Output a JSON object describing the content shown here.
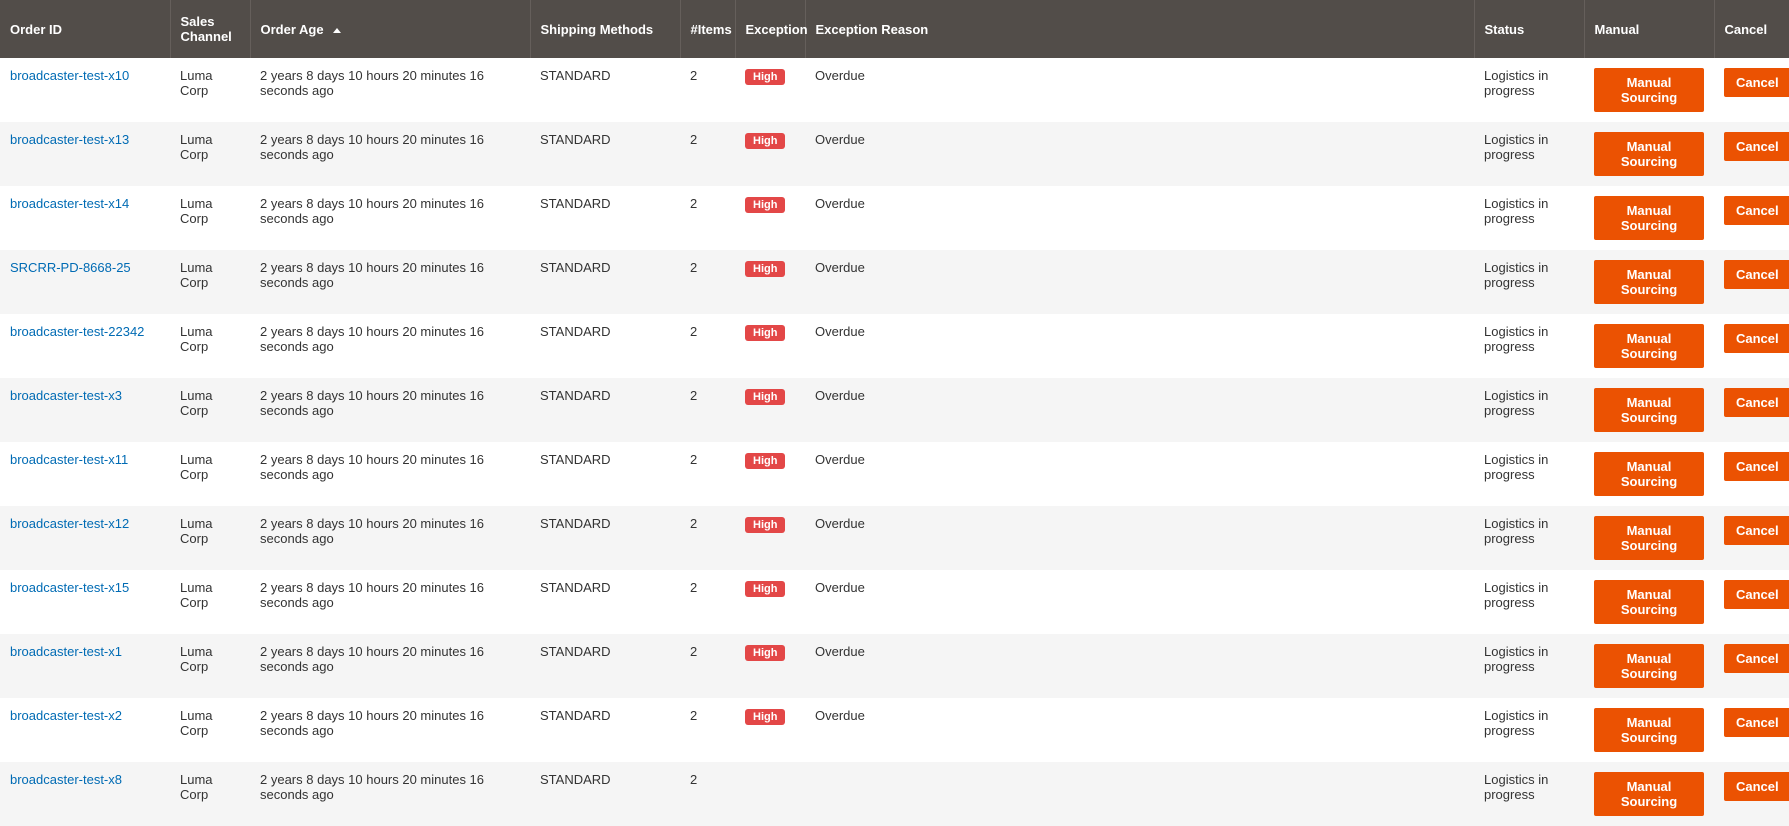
{
  "table": {
    "headers": {
      "order_id": "Order ID",
      "sales_channel": "Sales Channel",
      "order_age": "Order Age",
      "shipping_methods": "Shipping Methods",
      "items": "#Items",
      "exception": "Exception",
      "exception_reason": "Exception Reason",
      "status": "Status",
      "manual": "Manual",
      "cancel": "Cancel"
    },
    "sort_column": "order_age",
    "sort_direction": "asc",
    "buttons": {
      "manual_sourcing": "Manual Sourcing",
      "cancel": "Cancel"
    },
    "exception_labels": {
      "high": "High"
    },
    "rows": [
      {
        "order_id": "broadcaster-test-x10",
        "sales_channel": "Luma Corp",
        "order_age": "2 years 8 days 10 hours 20 minutes 16 seconds ago",
        "shipping_methods": "STANDARD",
        "items": "2",
        "exception": "High",
        "exception_reason": "Overdue",
        "status": "Logistics in progress"
      },
      {
        "order_id": "broadcaster-test-x13",
        "sales_channel": "Luma Corp",
        "order_age": "2 years 8 days 10 hours 20 minutes 16 seconds ago",
        "shipping_methods": "STANDARD",
        "items": "2",
        "exception": "High",
        "exception_reason": "Overdue",
        "status": "Logistics in progress"
      },
      {
        "order_id": "broadcaster-test-x14",
        "sales_channel": "Luma Corp",
        "order_age": "2 years 8 days 10 hours 20 minutes 16 seconds ago",
        "shipping_methods": "STANDARD",
        "items": "2",
        "exception": "High",
        "exception_reason": "Overdue",
        "status": "Logistics in progress"
      },
      {
        "order_id": "SRCRR-PD-8668-25",
        "sales_channel": "Luma Corp",
        "order_age": "2 years 8 days 10 hours 20 minutes 16 seconds ago",
        "shipping_methods": "STANDARD",
        "items": "2",
        "exception": "High",
        "exception_reason": "Overdue",
        "status": "Logistics in progress"
      },
      {
        "order_id": "broadcaster-test-22342",
        "sales_channel": "Luma Corp",
        "order_age": "2 years 8 days 10 hours 20 minutes 16 seconds ago",
        "shipping_methods": "STANDARD",
        "items": "2",
        "exception": "High",
        "exception_reason": "Overdue",
        "status": "Logistics in progress"
      },
      {
        "order_id": "broadcaster-test-x3",
        "sales_channel": "Luma Corp",
        "order_age": "2 years 8 days 10 hours 20 minutes 16 seconds ago",
        "shipping_methods": "STANDARD",
        "items": "2",
        "exception": "High",
        "exception_reason": "Overdue",
        "status": "Logistics in progress"
      },
      {
        "order_id": "broadcaster-test-x11",
        "sales_channel": "Luma Corp",
        "order_age": "2 years 8 days 10 hours 20 minutes 16 seconds ago",
        "shipping_methods": "STANDARD",
        "items": "2",
        "exception": "High",
        "exception_reason": "Overdue",
        "status": "Logistics in progress"
      },
      {
        "order_id": "broadcaster-test-x12",
        "sales_channel": "Luma Corp",
        "order_age": "2 years 8 days 10 hours 20 minutes 16 seconds ago",
        "shipping_methods": "STANDARD",
        "items": "2",
        "exception": "High",
        "exception_reason": "Overdue",
        "status": "Logistics in progress"
      },
      {
        "order_id": "broadcaster-test-x15",
        "sales_channel": "Luma Corp",
        "order_age": "2 years 8 days 10 hours 20 minutes 16 seconds ago",
        "shipping_methods": "STANDARD",
        "items": "2",
        "exception": "High",
        "exception_reason": "Overdue",
        "status": "Logistics in progress"
      },
      {
        "order_id": "broadcaster-test-x1",
        "sales_channel": "Luma Corp",
        "order_age": "2 years 8 days 10 hours 20 minutes 16 seconds ago",
        "shipping_methods": "STANDARD",
        "items": "2",
        "exception": "High",
        "exception_reason": "Overdue",
        "status": "Logistics in progress"
      },
      {
        "order_id": "broadcaster-test-x2",
        "sales_channel": "Luma Corp",
        "order_age": "2 years 8 days 10 hours 20 minutes 16 seconds ago",
        "shipping_methods": "STANDARD",
        "items": "2",
        "exception": "High",
        "exception_reason": "Overdue",
        "status": "Logistics in progress"
      },
      {
        "order_id": "broadcaster-test-x8",
        "sales_channel": "Luma Corp",
        "order_age": "2 years 8 days 10 hours 20 minutes 16 seconds ago",
        "shipping_methods": "STANDARD",
        "items": "2",
        "exception": "",
        "exception_reason": "",
        "status": "Logistics in progress"
      }
    ]
  }
}
